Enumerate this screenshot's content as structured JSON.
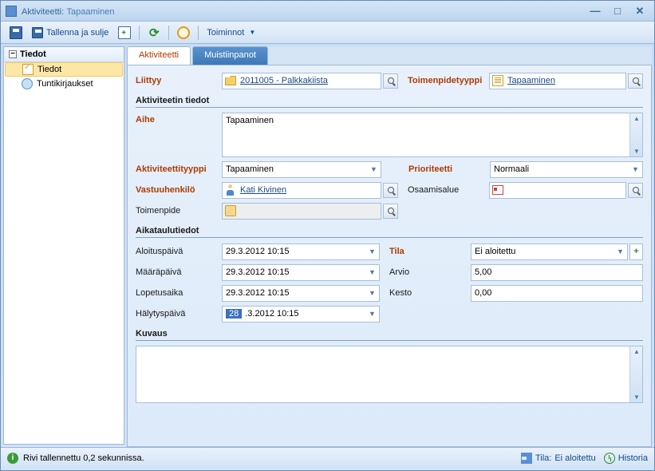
{
  "titlebar": {
    "prefix": "Aktiviteetti:",
    "value": "Tapaaminen"
  },
  "toolbar": {
    "save_close": "Tallenna ja sulje",
    "actions": "Toiminnot"
  },
  "sidebar": {
    "header": "Tiedot",
    "items": [
      {
        "label": "Tiedot"
      },
      {
        "label": "Tuntikirjaukset"
      }
    ]
  },
  "tabs": {
    "activity": "Aktiviteetti",
    "notes": "Muistiinpanot"
  },
  "form": {
    "liittyy": {
      "label": "Liittyy",
      "value": "2011005 - Palkkakiista"
    },
    "toimtyyppi": {
      "label": "Toimenpidetyyppi",
      "value": "Tapaaminen"
    },
    "section_details": "Aktiviteetin tiedot",
    "aihe": {
      "label": "Aihe",
      "value": "Tapaaminen"
    },
    "aktyyppi": {
      "label": "Aktiviteettityyppi",
      "value": "Tapaaminen"
    },
    "prioriteetti": {
      "label": "Prioriteetti",
      "value": "Normaali"
    },
    "vastuu": {
      "label": "Vastuuhenkilö",
      "value": "Kati Kivinen"
    },
    "osaamisalue": {
      "label": "Osaamisalue",
      "value": ""
    },
    "toimenpide": {
      "label": "Toimenpide",
      "value": ""
    },
    "section_schedule": "Aikataulutiedot",
    "aloitus": {
      "label": "Aloituspäivä",
      "value": "29.3.2012 10:15"
    },
    "maara": {
      "label": "Määräpäivä",
      "value": "29.3.2012 10:15"
    },
    "lopetus": {
      "label": "Lopetusaika",
      "value": "29.3.2012 10:15"
    },
    "halytys": {
      "label": "Hälytyspäivä",
      "value_hi": "28",
      "value_rest": ".3.2012 10:15"
    },
    "tila": {
      "label": "Tila",
      "value": "Ei aloitettu"
    },
    "arvio": {
      "label": "Arvio",
      "value": "5,00"
    },
    "kesto": {
      "label": "Kesto",
      "value": "0,00"
    },
    "section_kuvaus": "Kuvaus",
    "kuvaus_value": ""
  },
  "statusbar": {
    "saved": "Rivi tallennettu 0,2 sekunnissa.",
    "tila_prefix": "Tila:",
    "tila_value": "Ei aloitettu",
    "history": "Historia"
  }
}
